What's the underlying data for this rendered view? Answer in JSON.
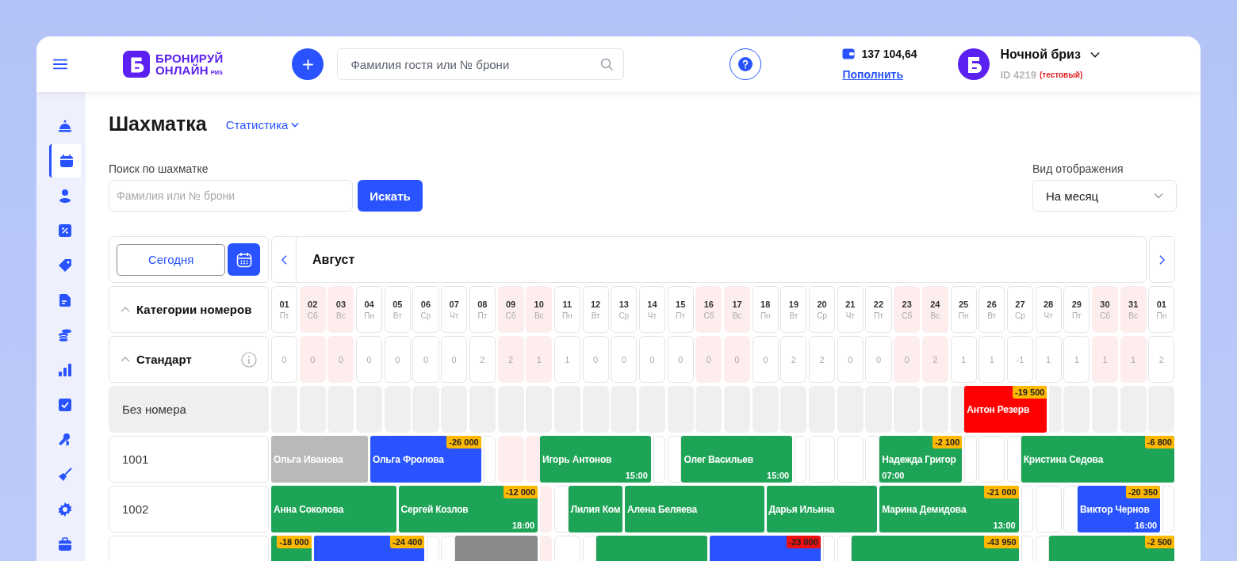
{
  "header": {
    "logo": {
      "line1": "БРОНИРУЙ",
      "line2": "ОНЛАЙН",
      "suffix": "PMS"
    },
    "search": {
      "placeholder": "Фамилия гостя или № брони"
    },
    "balance": {
      "amount": "137 104,64",
      "link": "Пополнить"
    },
    "account": {
      "name": "Ночной бриз",
      "id": "ID 4219",
      "tag": "(тестовый)"
    }
  },
  "sidebar": {
    "items": [
      {
        "kind": "bell",
        "selected": false
      },
      {
        "kind": "calendar",
        "selected": true
      },
      {
        "kind": "person",
        "selected": false
      },
      {
        "kind": "percent",
        "selected": false
      },
      {
        "kind": "tag",
        "selected": false
      },
      {
        "kind": "document",
        "selected": false
      },
      {
        "kind": "coins",
        "selected": false
      },
      {
        "kind": "chart",
        "selected": false
      },
      {
        "kind": "check",
        "selected": false
      },
      {
        "kind": "keys",
        "selected": false
      },
      {
        "kind": "broom",
        "selected": false
      },
      {
        "kind": "gear",
        "selected": false
      },
      {
        "kind": "briefcase",
        "selected": false
      }
    ]
  },
  "page": {
    "title": "Шахматка",
    "stats_menu": "Статистика",
    "search_label": "Поиск по шахматке",
    "search_placeholder": "Фамилия или № брони",
    "search_button": "Искать",
    "view_label": "Вид отображения",
    "view_value": "На месяц"
  },
  "board": {
    "today_button": "Сегодня",
    "month": "Август",
    "categories_label": "Категории номеров",
    "categories_expanded": true,
    "category": {
      "name": "Стандарт",
      "expanded": true
    },
    "days": [
      {
        "num": "01",
        "weekday": "Пт",
        "weekend": false,
        "free": "0"
      },
      {
        "num": "02",
        "weekday": "Сб",
        "weekend": true,
        "free": "0"
      },
      {
        "num": "03",
        "weekday": "Вс",
        "weekend": true,
        "free": "0"
      },
      {
        "num": "04",
        "weekday": "Пн",
        "weekend": false,
        "free": "0"
      },
      {
        "num": "05",
        "weekday": "Вт",
        "weekend": false,
        "free": "0"
      },
      {
        "num": "06",
        "weekday": "Ср",
        "weekend": false,
        "free": "0"
      },
      {
        "num": "07",
        "weekday": "Чт",
        "weekend": false,
        "free": "0"
      },
      {
        "num": "08",
        "weekday": "Пт",
        "weekend": false,
        "free": "2"
      },
      {
        "num": "09",
        "weekday": "Сб",
        "weekend": true,
        "free": "2"
      },
      {
        "num": "10",
        "weekday": "Вс",
        "weekend": true,
        "free": "1"
      },
      {
        "num": "11",
        "weekday": "Пн",
        "weekend": false,
        "free": "1"
      },
      {
        "num": "12",
        "weekday": "Вт",
        "weekend": false,
        "free": "0"
      },
      {
        "num": "13",
        "weekday": "Ср",
        "weekend": false,
        "free": "0"
      },
      {
        "num": "14",
        "weekday": "Чт",
        "weekend": false,
        "free": "0"
      },
      {
        "num": "15",
        "weekday": "Пт",
        "weekend": false,
        "free": "0"
      },
      {
        "num": "16",
        "weekday": "Сб",
        "weekend": true,
        "free": "0"
      },
      {
        "num": "17",
        "weekday": "Вс",
        "weekend": true,
        "free": "0"
      },
      {
        "num": "18",
        "weekday": "Пн",
        "weekend": false,
        "free": "0"
      },
      {
        "num": "19",
        "weekday": "Вт",
        "weekend": false,
        "free": "2"
      },
      {
        "num": "20",
        "weekday": "Ср",
        "weekend": false,
        "free": "2"
      },
      {
        "num": "21",
        "weekday": "Чт",
        "weekend": false,
        "free": "0"
      },
      {
        "num": "22",
        "weekday": "Пт",
        "weekend": false,
        "free": "0"
      },
      {
        "num": "23",
        "weekday": "Сб",
        "weekend": true,
        "free": "0"
      },
      {
        "num": "24",
        "weekday": "Вс",
        "weekend": true,
        "free": "2"
      },
      {
        "num": "25",
        "weekday": "Пн",
        "weekend": false,
        "free": "1"
      },
      {
        "num": "26",
        "weekday": "Вт",
        "weekend": false,
        "free": "1"
      },
      {
        "num": "27",
        "weekday": "Ср",
        "weekend": false,
        "free": "-1"
      },
      {
        "num": "28",
        "weekday": "Чт",
        "weekend": false,
        "free": "1"
      },
      {
        "num": "29",
        "weekday": "Пт",
        "weekend": false,
        "free": "1"
      },
      {
        "num": "30",
        "weekday": "Сб",
        "weekend": true,
        "free": "1"
      },
      {
        "num": "31",
        "weekday": "Вс",
        "weekend": true,
        "free": "1"
      },
      {
        "num": "01",
        "weekday": "Пн",
        "weekend": false,
        "free": "2"
      }
    ],
    "rooms": [
      {
        "label": "Без номера",
        "kind": "unassigned",
        "bookings": [
          {
            "kind": "booking",
            "name": "Антон Резерв",
            "color": "#ff0000",
            "badge": {
              "kind": "debt",
              "text": "-19 500"
            }
          }
        ]
      },
      {
        "label": "1001",
        "kind": "room",
        "bookings": [
          {
            "kind": "booking",
            "name": "Ольга Иванова",
            "color": "#b9b9b9"
          },
          {
            "kind": "booking",
            "name": "Ольга Фролова",
            "color": "#2853ff",
            "badge": {
              "kind": "debt",
              "text": "-26 000"
            }
          },
          {
            "kind": "booking",
            "name": "Игорь Антонов",
            "color": "#1ea456",
            "time": {
              "kind": "departure",
              "text": "15:00"
            }
          },
          {
            "kind": "booking",
            "name": "Олег Васильев",
            "color": "#1ea456",
            "time": {
              "kind": "departure",
              "text": "15:00"
            }
          },
          {
            "kind": "booking",
            "name": "Надежда Григор",
            "color": "#1ea456",
            "badge": {
              "kind": "debt",
              "text": "-2 100"
            },
            "time": {
              "kind": "arrival",
              "text": "07:00"
            }
          },
          {
            "kind": "booking",
            "name": "Кристина Седова",
            "color": "#1ea456",
            "badge": {
              "kind": "debt",
              "text": "-6 800"
            }
          }
        ]
      },
      {
        "label": "1002",
        "kind": "room",
        "bookings": [
          {
            "kind": "booking",
            "name": "Анна Соколова",
            "color": "#1ea456"
          },
          {
            "kind": "booking",
            "name": "Сергей Козлов",
            "color": "#1ea456",
            "badge": {
              "kind": "debt",
              "text": "-12 000"
            },
            "time": {
              "kind": "departure",
              "text": "18:00"
            }
          },
          {
            "kind": "booking",
            "name": "Лилия Ком",
            "color": "#1ea456"
          },
          {
            "kind": "booking",
            "name": "Алена Беляева",
            "color": "#1ea456"
          },
          {
            "kind": "booking",
            "name": "Дарья Ильина",
            "color": "#1ea456"
          },
          {
            "kind": "booking",
            "name": "Марина Демидова",
            "color": "#1ea456",
            "badge": {
              "kind": "debt",
              "text": "-21 000"
            },
            "time": {
              "kind": "departure",
              "text": "13:00"
            }
          },
          {
            "kind": "booking",
            "name": "Виктор Чернов",
            "color": "#2853ff",
            "badge": {
              "kind": "debt",
              "text": "-20 350"
            },
            "time": {
              "kind": "departure",
              "text": "16:00"
            }
          }
        ]
      },
      {
        "kind": "room",
        "bookings": [
          {
            "kind": "booking",
            "color": "#1ea456",
            "badge": {
              "kind": "debt",
              "text": "-18 000"
            }
          },
          {
            "kind": "booking",
            "color": "#2853ff",
            "badge": {
              "kind": "debt",
              "text": "-24 400"
            }
          },
          {
            "kind": "closed",
            "color": "#8a8a8a"
          },
          {
            "kind": "booking",
            "color": "#1ea456"
          },
          {
            "kind": "booking",
            "color": "#2853ff",
            "badge": {
              "kind": "overdue",
              "text": "-23 000"
            }
          },
          {
            "kind": "booking",
            "color": "#1ea456",
            "badge": {
              "kind": "debt",
              "text": "-43 950"
            }
          },
          {
            "kind": "booking",
            "color": "#1ea456",
            "badge": {
              "kind": "debt",
              "text": "-2 500"
            }
          }
        ]
      }
    ]
  }
}
